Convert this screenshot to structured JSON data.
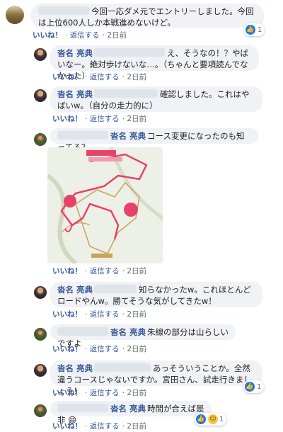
{
  "comments": [
    {
      "name": "",
      "text": "今回一応ダメ元でエントリーしました。今回は上位600人しか本戦進めないけど。",
      "like": "いいね！",
      "reply": "返信する",
      "time": "2日前",
      "reactions": "1"
    },
    {
      "name": "沓名 亮典",
      "text": "え、そうなの！？やばいなー。絶対歩けないな…。（ちゃんと要項読んでなかった）",
      "like": "いいね！",
      "reply": "返信する",
      "time": "2日前"
    },
    {
      "name": "沓名 亮典",
      "text": "確認しました。これはやばいw。（自分の走力的に）",
      "like": "いいね！",
      "reply": "返信する",
      "time": "2日前"
    },
    {
      "name": "沓名 亮典",
      "text": "コース変更になったのも知ってる？",
      "like": "いいね！",
      "reply": "返信する",
      "time": "2日前"
    },
    {
      "name": "沓名 亮典",
      "text": "知らなかったw。これほとんどロードやんw。勝てそうな気がしてきたw！",
      "like": "いいね！",
      "reply": "返信する",
      "time": "2日前"
    },
    {
      "name": "沓名 亮典",
      "text": "朱線の部分は山らしいですよ",
      "like": "いいね！",
      "reply": "返信する",
      "time": "2日前"
    },
    {
      "name": "沓名 亮典",
      "text": "あっそういうことか。全然違うコースじゃないですか。宮田さん、試走行きましょう！",
      "like": "いいね！",
      "reply": "返信する",
      "time": "2日前",
      "reactions": "1"
    },
    {
      "name": "沓名 亮典",
      "text": "時間が合えば是非",
      "like": "いいね！",
      "reply": "返信する",
      "time": "2日前",
      "reactions": "1"
    }
  ],
  "icons": {
    "like": "thumbs-up-icon",
    "haha": "smile-icon"
  },
  "colors": {
    "bubble": "#f0f2f5",
    "link": "#385898",
    "reaction_blue": "#1877f2",
    "route": "#e8416b"
  }
}
